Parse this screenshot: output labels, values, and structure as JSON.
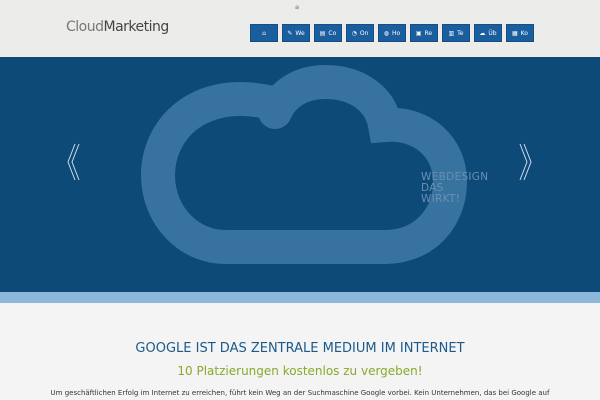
{
  "header": {
    "logo_part1": "Cloud",
    "logo_part2": "Marketing",
    "lock_icon": "lock-icon"
  },
  "nav": [
    {
      "icon": "⌂",
      "label": "",
      "name": "home"
    },
    {
      "icon": "✎",
      "label": "We",
      "name": "webdesign"
    },
    {
      "icon": "▤",
      "label": "Co",
      "name": "content"
    },
    {
      "icon": "◔",
      "label": "On",
      "name": "online"
    },
    {
      "icon": "◍",
      "label": "Ho",
      "name": "hosting"
    },
    {
      "icon": "▣",
      "label": "Re",
      "name": "referenzen"
    },
    {
      "icon": "▥",
      "label": "Te",
      "name": "team"
    },
    {
      "icon": "☁",
      "label": "Üb",
      "name": "ueber"
    },
    {
      "icon": "▦",
      "label": "Ko",
      "name": "kontakt"
    }
  ],
  "banner": {
    "slogan_line1": "WEBDESIGN",
    "slogan_line2": "DAS",
    "slogan_line3": "WIRKT!"
  },
  "content": {
    "heading": "GOOGLE IST DAS ZENTRALE MEDIUM IM INTERNET",
    "subheading": "10 Platzierungen kostenlos zu vergeben!",
    "paragraph": "Um geschäftlichen Erfolg im Internet zu erreichen, führt kein Weg an der Suchmaschine Google vorbei. Kein Unternehmen, das bei Google auf"
  },
  "colors": {
    "nav": "#1b5e9e",
    "banner": "#0e4a78",
    "accent": "#8aa82b"
  }
}
